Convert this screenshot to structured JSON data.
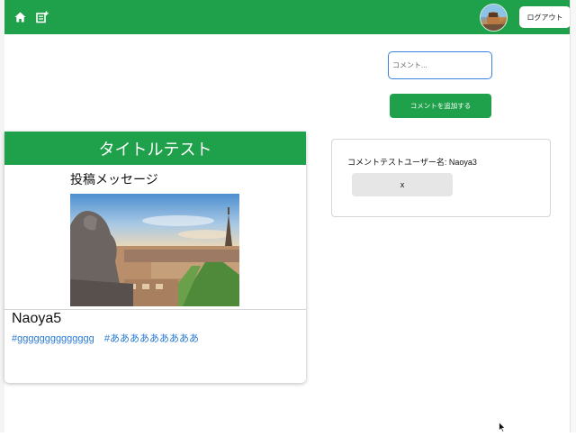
{
  "navbar": {
    "background": "#1fa04a",
    "home_icon": "home-icon",
    "new_post_icon": "new-post-icon",
    "avatar_icon": "user-avatar",
    "logout_label": "ログアウト"
  },
  "comment_form": {
    "placeholder": "コメント...",
    "value": "",
    "submit_label": "コメントを追加する"
  },
  "post": {
    "title": "タイトルテスト",
    "message": "投稿メッセージ",
    "image_alt": "Paris cityscape with gargoyle and Eiffel Tower",
    "username": "Naoya5",
    "tags": [
      "#gggggggggggggg",
      "#あああああああああ"
    ]
  },
  "comments": [
    {
      "text": "コメントテストユーザー名: Naoya3",
      "delete_label": "x"
    }
  ],
  "colors": {
    "accent": "#1fa04a",
    "link": "#2a7ad3",
    "focus": "#3b82e0"
  }
}
